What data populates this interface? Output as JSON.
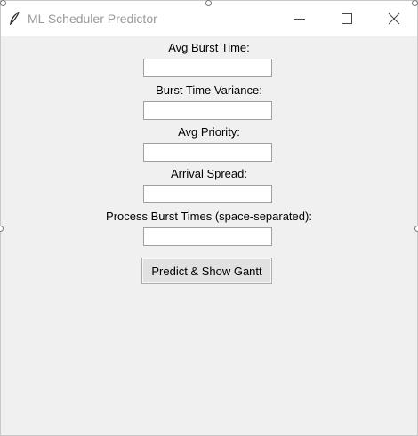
{
  "window": {
    "title": "ML Scheduler Predictor",
    "app_icon": "feather-icon",
    "controls": [
      "minimize-icon",
      "maximize-icon",
      "close-icon"
    ]
  },
  "form": {
    "fields": [
      {
        "label": "Avg Burst Time:",
        "value": ""
      },
      {
        "label": "Burst Time Variance:",
        "value": ""
      },
      {
        "label": "Avg Priority:",
        "value": ""
      },
      {
        "label": "Arrival Spread:",
        "value": ""
      },
      {
        "label": "Process Burst Times (space-separated):",
        "value": ""
      }
    ],
    "submit_label": "Predict & Show Gantt"
  }
}
